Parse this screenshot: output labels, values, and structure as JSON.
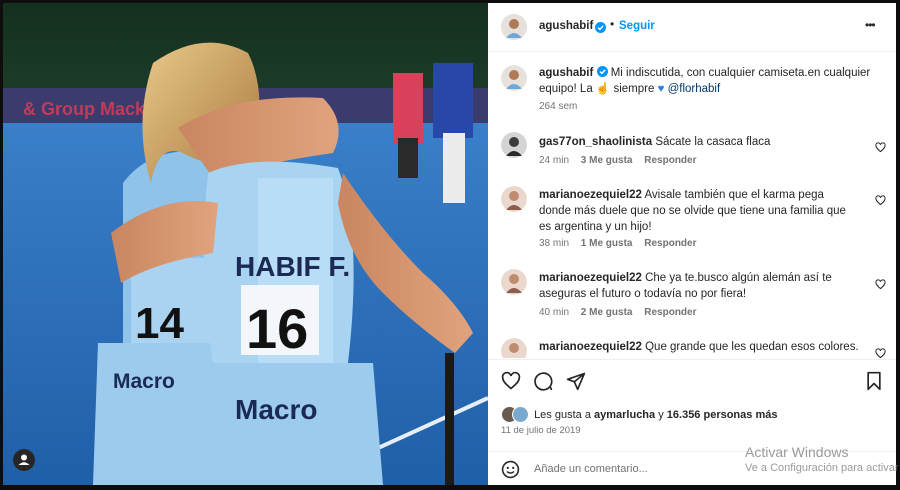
{
  "post": {
    "username": "agushabif",
    "follow_label": "Seguir",
    "more_label": "•••",
    "caption_text": "Mi indiscutida, con cualquier camiseta.en cualquier equipo! La",
    "caption_tail": "siempre",
    "caption_mention": "@florhabif",
    "caption_age": "264 sem",
    "likes_prefix": "Les gusta a",
    "likes_user": "aymarlucha",
    "likes_joiner": "y",
    "likes_count": "16.356 personas más",
    "date": "11 de julio de 2019",
    "comment_placeholder": "Añade un comentario...",
    "verified_color": "#0095f6"
  },
  "photo": {
    "jersey_name": "HABIF F.",
    "jersey_number": "16",
    "left_number": "14",
    "sponsor": "Macro",
    "sponsor2": "Macro",
    "banner_text": "& Group Mackie"
  },
  "comments": [
    {
      "user": "gas77on_shaolinista",
      "text": "Sácate la casaca flaca",
      "age": "24 min",
      "likes": "3 Me gusta",
      "reply": "Responder"
    },
    {
      "user": "marianoezequiel22",
      "text": "Avisale también que el karma pega donde más duele que no se olvide que tiene una familia que es argentina y un hijo!",
      "age": "38 min",
      "likes": "1 Me gusta",
      "reply": "Responder"
    },
    {
      "user": "marianoezequiel22",
      "text": "Che ya te.busco algún alemán así te aseguras el futuro o todavía no por fiera!",
      "age": "40 min",
      "likes": "2 Me gusta",
      "reply": "Responder"
    },
    {
      "user": "marianoezequiel22",
      "text": "Que grande que les quedan esos colores."
    }
  ],
  "watermark": {
    "title": "Activar Windows",
    "subtitle": "Ve a Configuración para activar"
  }
}
